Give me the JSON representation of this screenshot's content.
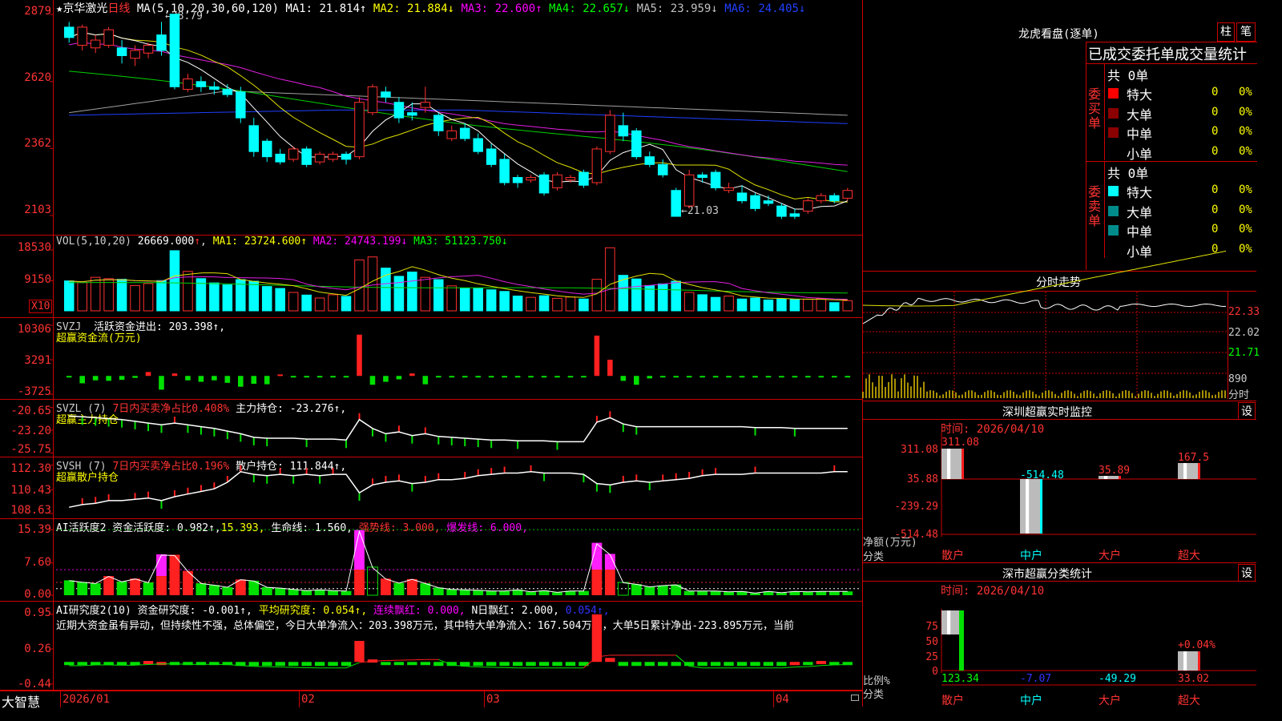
{
  "header": {
    "star": "★",
    "stock": "京华激光",
    "period": "日线",
    "ma_label": "MA(5,10,20,30,60,120)",
    "ma": [
      {
        "name": "MA1:",
        "val": "21.814",
        "arrow": "↑",
        "color": "#ffffff"
      },
      {
        "name": "MA2:",
        "val": "21.884",
        "arrow": "↓",
        "color": "#ffff00"
      },
      {
        "name": "MA3:",
        "val": "22.600",
        "arrow": "↑",
        "color": "#ff00ff"
      },
      {
        "name": "MA4:",
        "val": "22.657",
        "arrow": "↓",
        "color": "#00ff00"
      },
      {
        "name": "MA5:",
        "val": "23.959",
        "arrow": "↓",
        "color": "#c0c0c0"
      },
      {
        "name": "MA6:",
        "val": "24.405",
        "arrow": "↓",
        "color": "#2040ff"
      }
    ]
  },
  "price_axis": [
    "2879",
    "2620",
    "2362",
    "2103"
  ],
  "annot_high": "28.79",
  "annot_low": "21.03",
  "vol": {
    "label": "VOL(5,10,20)",
    "value": "26669.000",
    "arrow": "↑",
    "ma1": "MA1: 23724.600↑",
    "ma2": "MA2: 24743.199↓",
    "ma3": "MA3: 51123.750↓",
    "axis": [
      "18530",
      "9150"
    ],
    "unit": "X10"
  },
  "svzj": {
    "label": "SVZJ",
    "title": "活跃资金进出: 203.398↑,",
    "sub": "超赢资金流(万元)",
    "axis": [
      "10306",
      "3291",
      "-3725"
    ]
  },
  "svzl": {
    "label": "SVZL (7)",
    "t1": "7日内买卖净占比0.408%",
    "t2": "主力持仓: -23.276↑,",
    "sub": "超赢主力持仓",
    "axis": [
      "-20.65",
      "-23.20",
      "-25.75"
    ]
  },
  "svsh": {
    "label": "SVSH (7)",
    "t1": "7日内买卖净占比0.196%",
    "t2": "散户持仓: 111.844↑,",
    "sub": "超赢散户持仓",
    "axis": [
      "112.30",
      "110.43",
      "108.63"
    ]
  },
  "ai1": {
    "t1": "AI活跃度2 资金活跃度: 0.982↑,",
    "t2": "15.393,",
    "t3": "生命线: 1.560,",
    "t4": "强势线: 3.000,",
    "t5": "爆发线: 6.000,",
    "axis": [
      "15.39",
      "7.60",
      "0.00"
    ]
  },
  "ai2": {
    "t1": "AI研究度2(10) 资金研究度: -0.001↑,",
    "t2": "平均研究度: 0.054↑,",
    "t3": "连续飘红: 0.000,",
    "t4": "N日飘红: 2.000,",
    "t5": "0.054↑,",
    "text": "近期大资金虽有异动，但持续性不强，总体偏空，今日大单净流入：203.398万元，其中特大单净流入：167.504万元，大单5日累计净出-223.895万元，当前",
    "axis": [
      "0.95",
      "0.26",
      "-0.44"
    ]
  },
  "xaxis": [
    "2026/01",
    "02",
    "03",
    "04"
  ],
  "brand": "大智慧",
  "right": {
    "lhk_title": "龙虎看盘(逐单)",
    "btn1": "柱",
    "btn2": "笔",
    "stat_title": "已成交委托单成交量统计",
    "buy_side": "委买单",
    "sell_side": "委卖单",
    "buy_total": "共 0单",
    "sell_total": "共 0单",
    "rows": [
      "特大",
      "大单",
      "中单",
      "小单"
    ],
    "zero": "0",
    "pct": "0%",
    "fenshi_title": "分时走势",
    "fs_axis": [
      "22.33",
      "22.02",
      "21.71",
      "890",
      "分时"
    ],
    "sz_title": "深圳超赢实时监控",
    "sz_btn": "设",
    "sz_time": "时间: 2026/04/10",
    "sz_axis": [
      "311.08",
      "35.88",
      "-239.29",
      "-514.48"
    ],
    "sz_vals": [
      "311.08",
      "-514.48",
      "35.89",
      "167.5"
    ],
    "sz_unit": "净额(万元)",
    "sz_cls": "分类",
    "cats": [
      "散户",
      "中户",
      "大户",
      "超大"
    ],
    "ss_title": "深市超赢分类统计",
    "ss_btn": "设",
    "ss_time": "时间: 2026/04/10",
    "ss_axis": [
      "75",
      "50",
      "25",
      "0"
    ],
    "ss_vals": [
      "123.34",
      "-7.07",
      "-49.29",
      "33.02"
    ],
    "ss_top": "+0.04%",
    "ss_unit": "比例%",
    "ss_cls": "分类"
  },
  "chart_data": {
    "type": "candlestick",
    "title": "京华激光 日线",
    "x_labels": [
      "2026/01",
      "02",
      "03",
      "04"
    ],
    "ylim": [
      21.03,
      28.79
    ],
    "candles": [
      [
        28.3,
        27.9,
        28.5,
        27.7
      ],
      [
        27.6,
        28.3,
        28.4,
        27.4
      ],
      [
        27.5,
        27.8,
        28.0,
        27.3
      ],
      [
        27.6,
        28.2,
        28.3,
        27.5
      ],
      [
        27.5,
        27.2,
        27.8,
        26.9
      ],
      [
        27.1,
        27.4,
        27.6,
        26.8
      ],
      [
        27.3,
        27.6,
        27.7,
        27.1
      ],
      [
        28.0,
        27.4,
        28.5,
        27.2
      ],
      [
        28.8,
        26.0,
        28.8,
        25.9
      ],
      [
        25.9,
        26.3,
        26.5,
        25.8
      ],
      [
        26.2,
        26.0,
        26.4,
        25.8
      ],
      [
        26.0,
        25.9,
        26.2,
        25.7
      ],
      [
        25.9,
        25.7,
        26.1,
        25.6
      ],
      [
        25.8,
        24.8,
        26.0,
        24.6
      ],
      [
        24.5,
        23.5,
        24.8,
        23.3
      ],
      [
        23.9,
        23.3,
        24.0,
        23.1
      ],
      [
        23.4,
        23.1,
        23.6,
        23.0
      ],
      [
        23.2,
        23.6,
        23.7,
        23.1
      ],
      [
        23.6,
        23.0,
        23.7,
        22.9
      ],
      [
        23.1,
        23.4,
        23.5,
        23.0
      ],
      [
        23.2,
        23.4,
        23.5,
        23.1
      ],
      [
        23.4,
        23.2,
        23.5,
        23.0
      ],
      [
        23.3,
        25.4,
        25.6,
        23.2
      ],
      [
        25.0,
        26.0,
        26.1,
        24.9
      ],
      [
        25.8,
        25.6,
        26.0,
        25.4
      ],
      [
        25.4,
        24.8,
        25.6,
        24.6
      ],
      [
        25.0,
        24.9,
        25.4,
        24.7
      ],
      [
        25.2,
        25.4,
        26.0,
        25.0
      ],
      [
        24.9,
        24.3,
        25.0,
        24.1
      ],
      [
        24.0,
        24.3,
        24.5,
        23.9
      ],
      [
        24.4,
        24.0,
        24.6,
        23.9
      ],
      [
        24.0,
        23.5,
        24.2,
        23.4
      ],
      [
        23.6,
        23.0,
        23.8,
        22.9
      ],
      [
        23.2,
        22.3,
        23.4,
        22.2
      ],
      [
        22.5,
        22.3,
        22.6,
        22.1
      ],
      [
        22.4,
        22.5,
        22.6,
        22.3
      ],
      [
        22.6,
        21.9,
        22.7,
        21.8
      ],
      [
        22.1,
        22.6,
        22.7,
        22.0
      ],
      [
        22.4,
        22.5,
        22.6,
        22.3
      ],
      [
        22.7,
        22.2,
        22.8,
        22.1
      ],
      [
        22.3,
        23.6,
        23.7,
        22.2
      ],
      [
        23.5,
        24.9,
        25.1,
        23.4
      ],
      [
        24.5,
        24.1,
        25.0,
        23.9
      ],
      [
        24.3,
        23.3,
        24.4,
        23.2
      ],
      [
        23.3,
        23.0,
        23.5,
        22.9
      ],
      [
        23.0,
        22.6,
        23.2,
        22.5
      ],
      [
        22.0,
        21.0,
        22.1,
        21.0
      ],
      [
        21.4,
        22.6,
        22.8,
        21.3
      ],
      [
        22.6,
        22.5,
        22.7,
        22.3
      ],
      [
        22.7,
        22.1,
        22.8,
        22.0
      ],
      [
        22.0,
        22.1,
        22.3,
        21.9
      ],
      [
        21.9,
        21.6,
        22.2,
        21.5
      ],
      [
        21.8,
        21.3,
        21.9,
        21.2
      ],
      [
        21.6,
        21.5,
        21.8,
        21.4
      ],
      [
        21.4,
        21.0,
        21.5,
        20.9
      ],
      [
        21.1,
        21.0,
        21.3,
        20.9
      ],
      [
        21.2,
        21.6,
        21.7,
        21.1
      ],
      [
        21.6,
        21.8,
        21.9,
        21.5
      ],
      [
        21.8,
        21.6,
        21.9,
        21.5
      ],
      [
        21.7,
        22.0,
        22.1,
        21.6
      ]
    ],
    "vol": [
      9.1,
      8.6,
      10.2,
      9.8,
      9.6,
      7.7,
      8.3,
      9.2,
      18.3,
      12.0,
      9.8,
      8.5,
      7.9,
      9.5,
      9.0,
      7.4,
      6.8,
      5.6,
      4.8,
      3.9,
      4.9,
      4.4,
      15.5,
      16.4,
      13.0,
      10.5,
      11.8,
      10.2,
      9.5,
      7.6,
      6.9,
      6.9,
      6.4,
      5.9,
      4.5,
      4.1,
      4.6,
      3.8,
      4.2,
      3.6,
      9.6,
      19.2,
      10.8,
      9.7,
      7.7,
      8.2,
      9.0,
      5.6,
      4.9,
      4.1,
      4.5,
      3.6,
      3.9,
      3.3,
      3.6,
      3.5,
      3.5,
      3.7,
      2.5,
      3.1
    ],
    "svzj": [
      -300,
      -1500,
      -900,
      -1000,
      -800,
      -400,
      800,
      -2800,
      500,
      -900,
      -1200,
      -900,
      -1400,
      -2200,
      -1600,
      -1700,
      300,
      -300,
      -300,
      -300,
      -300,
      -300,
      8400,
      -1800,
      -1200,
      -700,
      500,
      -1700,
      -300,
      -300,
      -300,
      -300,
      -300,
      -300,
      -300,
      -300,
      -300,
      -300,
      -300,
      -300,
      8200,
      3300,
      -1000,
      -1800,
      -500,
      -300,
      -300,
      -300,
      -300,
      -300,
      -300,
      -300,
      -300,
      -300,
      -300,
      -300,
      -300,
      -300,
      -300,
      -300
    ],
    "svzl": [
      -21.6,
      -21.7,
      -21.8,
      -21.9,
      -22.0,
      -22.2,
      -22.4,
      -22.6,
      -22.4,
      -22.6,
      -22.8,
      -23.0,
      -23.3,
      -23.6,
      -24.0,
      -24.1,
      -24.1,
      -24.1,
      -24.2,
      -24.2,
      -24.2,
      -24.3,
      -22.0,
      -23.0,
      -23.6,
      -23.4,
      -23.8,
      -23.6,
      -23.9,
      -24.0,
      -24.1,
      -24.2,
      -24.3,
      -24.3,
      -24.4,
      -24.4,
      -24.4,
      -24.5,
      -24.5,
      -24.5,
      -22.3,
      -21.8,
      -22.5,
      -22.8,
      -22.8,
      -22.8,
      -22.8,
      -22.8,
      -22.8,
      -22.8,
      -22.8,
      -22.8,
      -22.9,
      -22.9,
      -22.9,
      -23.0,
      -23.0,
      -23.0,
      -23.0,
      -23.0
    ],
    "svsh": [
      109.1,
      109.3,
      109.4,
      109.6,
      109.6,
      109.7,
      109.8,
      109.6,
      109.9,
      110.1,
      110.3,
      110.5,
      111.0,
      111.8,
      111.6,
      111.5,
      111.6,
      111.5,
      111.6,
      111.5,
      111.6,
      111.6,
      110.2,
      110.8,
      111.0,
      111.1,
      110.9,
      111.0,
      111.2,
      111.2,
      111.3,
      111.5,
      111.6,
      111.7,
      111.7,
      111.8,
      111.7,
      111.7,
      111.7,
      111.6,
      110.9,
      110.8,
      111.0,
      111.1,
      111.0,
      111.1,
      111.2,
      111.3,
      111.5,
      111.6,
      111.6,
      111.6,
      111.7,
      111.7,
      111.7,
      111.7,
      111.7,
      111.7,
      111.8,
      111.8
    ],
    "ai1": [
      3.5,
      3.1,
      2.8,
      4.5,
      3.2,
      3.9,
      3.0,
      4.5,
      9.5,
      5.7,
      2.8,
      2.4,
      1.9,
      3.7,
      3.4,
      1.9,
      1.7,
      1.4,
      1.1,
      1.3,
      1.1,
      1.0,
      15.3,
      6.6,
      3.9,
      2.9,
      3.8,
      2.8,
      1.8,
      1.4,
      1.3,
      1.2,
      1.0,
      1.0,
      1.3,
      0.8,
      1.1,
      0.7,
      1.0,
      1.0,
      12.3,
      9.7,
      3.0,
      2.6,
      2.0,
      2.3,
      2.5,
      1.0,
      1.0,
      1.0,
      0.8,
      0.9,
      0.5,
      0.9,
      0.6,
      0.9,
      0.8,
      0.9,
      0.9,
      0.9
    ],
    "ai1_magenta": [
      0,
      0,
      0,
      0,
      0,
      0,
      0,
      9.6,
      0,
      0,
      0,
      0,
      0,
      0,
      0,
      0,
      0,
      0,
      0,
      0,
      0,
      0,
      15.3,
      0,
      0,
      0,
      0,
      0,
      0,
      0,
      0,
      0,
      0,
      0,
      0,
      0,
      0,
      0,
      0,
      0,
      12.3,
      9.7,
      0,
      0,
      0,
      0,
      0,
      0,
      0,
      0,
      0,
      0,
      0,
      0,
      0,
      0,
      0,
      0,
      0,
      0
    ],
    "ai2": [
      -0.05,
      -0.05,
      -0.02,
      -0.04,
      -0.06,
      -0.04,
      0.02,
      0.0,
      -0.05,
      -0.05,
      -0.05,
      -0.05,
      -0.06,
      -0.08,
      -0.08,
      -0.08,
      -0.08,
      -0.08,
      -0.08,
      -0.08,
      -0.08,
      -0.08,
      0.42,
      0.05,
      -0.02,
      -0.05,
      -0.05,
      -0.05,
      -0.08,
      -0.08,
      -0.08,
      -0.08,
      -0.08,
      -0.08,
      -0.08,
      -0.08,
      -0.08,
      -0.08,
      -0.08,
      -0.08,
      0.95,
      0.08,
      -0.08,
      -0.08,
      -0.08,
      -0.08,
      -0.08,
      -0.08,
      -0.08,
      -0.08,
      -0.08,
      -0.08,
      -0.08,
      -0.08,
      -0.08,
      0.0,
      -0.04,
      0.02,
      -0.02,
      -0.04
    ]
  }
}
